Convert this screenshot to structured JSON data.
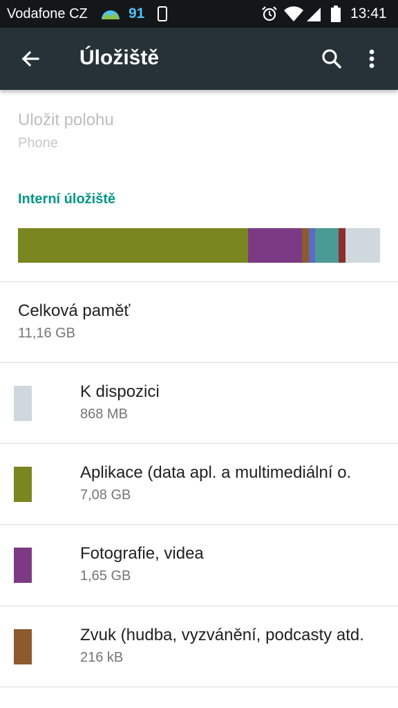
{
  "status_bar": {
    "carrier": "Vodafone CZ",
    "battery_percent": "91",
    "time": "13:41",
    "icons": [
      "weather-icon",
      "phone-vibrate-icon",
      "alarm-icon",
      "wifi-icon",
      "signal-icon",
      "battery-icon"
    ]
  },
  "app_bar": {
    "title": "Úložiště",
    "background": "#263238",
    "icons": [
      "back-arrow-icon",
      "search-icon",
      "more-vert-icon"
    ]
  },
  "save_location": {
    "title": "Uložit polohu",
    "value": "Phone"
  },
  "internal_storage": {
    "header": "Interní úložiště",
    "accent": "#009688",
    "usage_bar": [
      {
        "category": "Aplikace",
        "fraction": 0.636,
        "color": "#7a861f"
      },
      {
        "category": "Fotografie, videa",
        "fraction": 0.148,
        "color": "#7b3a83"
      },
      {
        "category": "Zvuk",
        "fraction": 0.019,
        "color": "#8d5a2e"
      },
      {
        "category": "other-1",
        "fraction": 0.017,
        "color": "#5c6bc0"
      },
      {
        "category": "other-2",
        "fraction": 0.066,
        "color": "#4a9a96"
      },
      {
        "category": "other-3",
        "fraction": 0.019,
        "color": "#8b2f2f"
      },
      {
        "category": "K dispozici",
        "fraction": 0.095,
        "color": "#cfd8dc"
      }
    ]
  },
  "total": {
    "title": "Celková paměť",
    "value": "11,16 GB"
  },
  "categories": [
    {
      "label": "K dispozici",
      "value": "868 MB",
      "color": "#cfd8dc"
    },
    {
      "label": "Aplikace (data apl. a multimediální o.",
      "value": "7,08 GB",
      "color": "#7a861f"
    },
    {
      "label": "Fotografie, videa",
      "value": "1,65 GB",
      "color": "#7b3a83"
    },
    {
      "label": "Zvuk (hudba, vyzvánění, podcasty atd.",
      "value": "216 kB",
      "color": "#8d5a2e"
    }
  ]
}
